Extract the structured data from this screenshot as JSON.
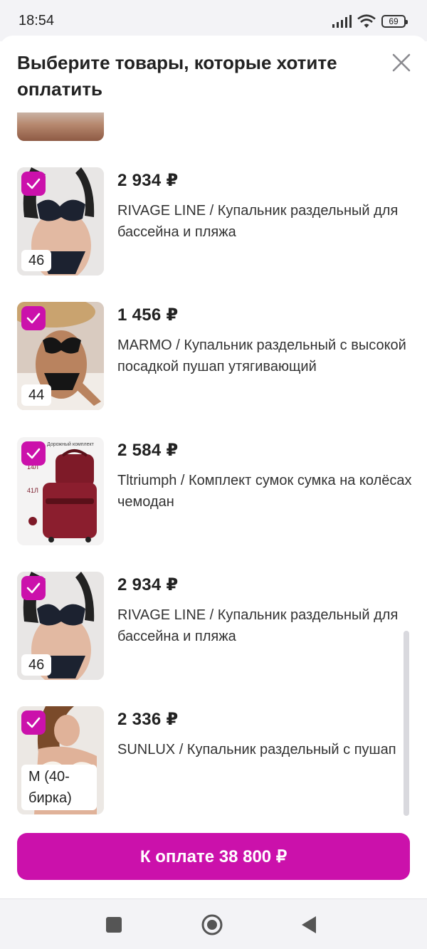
{
  "status_bar": {
    "time": "18:54",
    "battery": "69",
    "icons": [
      "signal-icon",
      "wifi-icon",
      "battery-icon"
    ]
  },
  "dialog": {
    "title": "Выберите товары, которые хотите оплатить",
    "close_icon": "close-icon"
  },
  "items": [
    {
      "price": "2 934 ₽",
      "name": "RIVAGE LINE / Купальник раздельный для бассейна и пляжа",
      "size": "46",
      "checked": true
    },
    {
      "price": "1 456 ₽",
      "name": "MARMO / Купальник раздельный с высокой посадкой пушап утягивающий",
      "size": "44",
      "checked": true
    },
    {
      "price": "2 584 ₽",
      "name": "Tltriumph / Комплект сумок сумка на колёсах чемодан",
      "size": "",
      "checked": true,
      "image_text": [
        "Дорожный комплект",
        "14Л",
        "41Л"
      ]
    },
    {
      "price": "2 934 ₽",
      "name": "RIVAGE LINE / Купальник раздельный для бассейна и пляжа",
      "size": "46",
      "checked": true
    },
    {
      "price": "2 336 ₽",
      "name": "SUNLUX / Купальник раздельный с пушап",
      "size": "M (40-бирка)",
      "checked": true
    }
  ],
  "pay_button": {
    "label": "К оплате 38 800 ₽"
  },
  "colors": {
    "accent": "#cb11ab",
    "text": "#222222",
    "bg": "#ffffff",
    "bars": "#f3f3f6"
  },
  "nav": [
    "recent-apps-icon",
    "home-icon",
    "back-icon"
  ]
}
